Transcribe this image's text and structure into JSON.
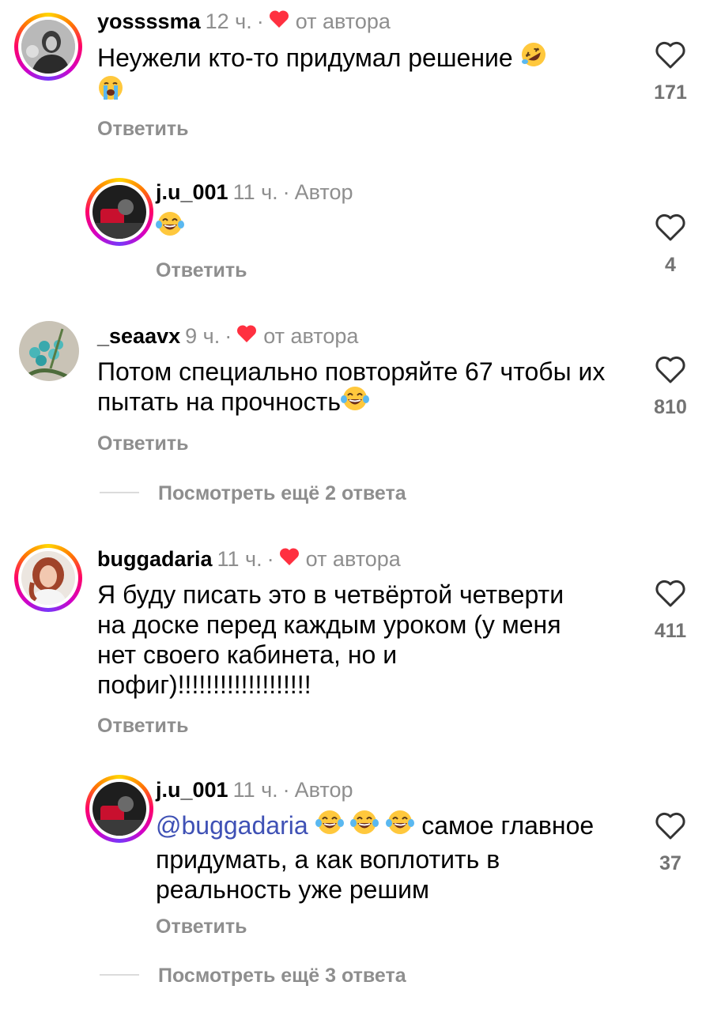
{
  "comments": [
    {
      "username": "yossssma",
      "time": "12 ч.",
      "author_tag": "от автора",
      "text": "Неужели кто-то придумал решение",
      "likes": "171",
      "reply_label": "Ответить",
      "liked_by_author": true,
      "emojis": [
        "rolling-on-floor-laughing-emoji",
        "loudly-crying-emoji"
      ]
    },
    {
      "username": "j.u_001",
      "time": "11 ч.",
      "author_tag": "Автор",
      "text": "",
      "likes": "4",
      "reply_label": "Ответить",
      "is_reply": true,
      "emojis": [
        "tears-of-joy-emoji"
      ]
    },
    {
      "username": "_seaavx",
      "time": "9 ч.",
      "author_tag": "от автора",
      "text": "Потом специально повторяйте 67 чтобы их пытать на прочность",
      "likes": "810",
      "reply_label": "Ответить",
      "liked_by_author": true,
      "emojis": [
        "tears-of-joy-emoji"
      ]
    },
    {
      "username": "buggadaria",
      "time": "11 ч.",
      "author_tag": "от автора",
      "text_lines": [
        "Я буду писать это в четвёртой четверти",
        "на доске перед каждым уроком (у меня",
        "нет своего кабинета, но и",
        "пофиг)!!!!!!!!!!!!!!!!!!!"
      ],
      "likes": "411",
      "reply_label": "Ответить",
      "liked_by_author": true
    },
    {
      "username": "j.u_001",
      "time": "11 ч.",
      "author_tag": "Автор",
      "mention": "@buggadaria",
      "text_after": "самое главное",
      "text_lines": [
        "придумать, а как воплотить в",
        "реальность уже решим"
      ],
      "likes": "37",
      "reply_label": "Ответить",
      "is_reply": true,
      "emojis": [
        "tears-of-joy-emoji",
        "tears-of-joy-emoji",
        "tears-of-joy-emoji"
      ]
    }
  ],
  "more_replies": [
    {
      "label": "Посмотреть ещё 2 ответа"
    },
    {
      "label": "Посмотреть ещё 3 ответа"
    }
  ],
  "colors": {
    "heart_red": "#ff3040",
    "secondary_text": "#8e8e8e",
    "mention_blue": "#3f51b5"
  }
}
